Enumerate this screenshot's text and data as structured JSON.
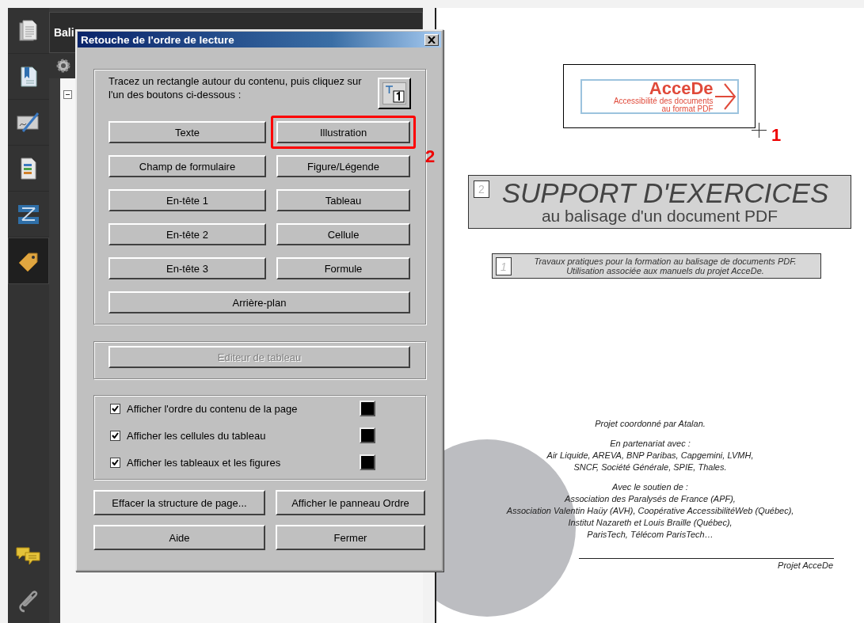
{
  "sidebar": {
    "items": [
      {
        "kind": "pages",
        "selected": false
      },
      {
        "kind": "bookmarks",
        "selected": false
      },
      {
        "kind": "signature",
        "selected": false
      },
      {
        "kind": "content",
        "selected": false
      },
      {
        "kind": "order",
        "selected": false
      },
      {
        "kind": "tags",
        "selected": true
      },
      {
        "kind": "comments",
        "selected": false
      },
      {
        "kind": "attachments",
        "selected": false
      }
    ]
  },
  "panel": {
    "title": "Bali"
  },
  "dialog": {
    "title": "Retouche de l'ordre de lecture",
    "instruction": "Tracez un rectangle autour du contenu, puis cliquez sur l'un des boutons ci-dessous :",
    "tag_buttons": [
      {
        "label": "Texte",
        "highlighted": false
      },
      {
        "label": "Illustration",
        "highlighted": true,
        "callout": "2"
      },
      {
        "label": "Champ de formulaire",
        "highlighted": false
      },
      {
        "label": "Figure/Légende",
        "highlighted": false
      },
      {
        "label": "En-tête 1",
        "highlighted": false
      },
      {
        "label": "Tableau",
        "highlighted": false
      },
      {
        "label": "En-tête 2",
        "highlighted": false
      },
      {
        "label": "Cellule",
        "highlighted": false
      },
      {
        "label": "En-tête 3",
        "highlighted": false
      },
      {
        "label": "Formule",
        "highlighted": false
      },
      {
        "label": "Arrière-plan",
        "highlighted": false
      }
    ],
    "table_editor": {
      "label": "Editeur de tableau",
      "disabled": true
    },
    "options": [
      {
        "label": "Afficher l'ordre du contenu de la page",
        "checked": true,
        "color": "#000000"
      },
      {
        "label": "Afficher les cellules du tableau",
        "checked": true,
        "color": "#000000"
      },
      {
        "label": "Afficher les tableaux et les figures",
        "checked": true,
        "color": "#000000"
      }
    ],
    "buttons": [
      "Effacer la structure de page...",
      "Afficher le panneau Ordre",
      "Aide",
      "Fermer"
    ]
  },
  "document": {
    "logo": {
      "title": "AcceDe",
      "subtitle": "Accessibilité des documents",
      "subtitle_2": "au format PDF",
      "callout": "1"
    },
    "heading": {
      "order": "2",
      "title": "SUPPORT D'EXERCICES",
      "subtitle": "au balisage d'un document PDF"
    },
    "intro": {
      "order": "1",
      "lines": [
        "Travaux pratiques pour la formation au balisage de documents PDF.",
        "Utilisation associée aux manuels du projet AcceDe."
      ]
    },
    "credits": [
      {
        "lines": [
          "Projet coordonné par Atalan."
        ]
      },
      {
        "lines": [
          "En partenariat avec :",
          "Air Liquide, AREVA, BNP Paribas, Capgemini, LVMH,",
          "SNCF, Société Générale, SPIE, Thales."
        ]
      },
      {
        "lines": [
          "Avec le soutien de :",
          "Association des Paralysés de France (APF),",
          "Association Valentin Haüy (AVH), Coopérative AccessibilitéWeb (Québec),",
          "Institut Nazareth et Louis Braille (Québec),",
          "ParisTech, Télécom ParisTech…"
        ]
      }
    ],
    "footer": "Projet AcceDe"
  }
}
